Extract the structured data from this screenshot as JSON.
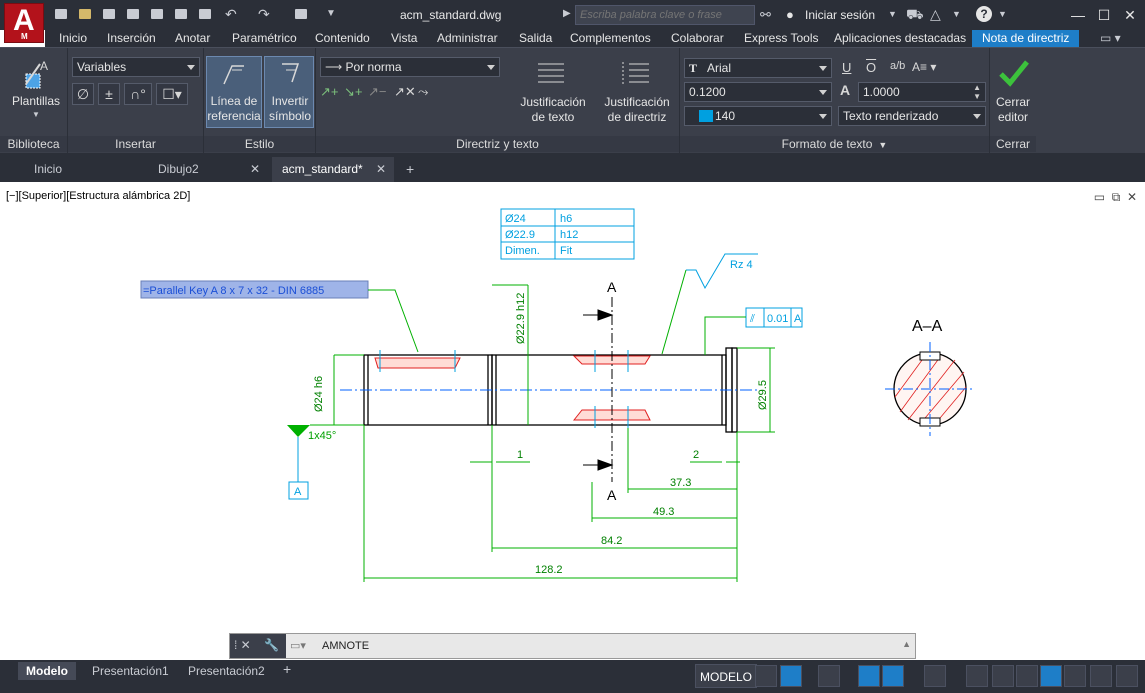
{
  "app": {
    "logo_letter": "A",
    "logo_sub": "M",
    "title": "acm_standard.dwg"
  },
  "search": {
    "placeholder": "Escriba palabra clave o frase"
  },
  "account": {
    "signin": "Iniciar sesión"
  },
  "ribbon_tabs": [
    "Inicio",
    "Inserción",
    "Anotar",
    "Paramétrico",
    "Contenido",
    "Vista",
    "Administrar",
    "Salida",
    "Complementos",
    "Colaborar",
    "Express Tools",
    "Aplicaciones destacadas",
    "Nota de directriz"
  ],
  "active_ribbon_tab": "Nota de directriz",
  "ribbon": {
    "biblioteca": {
      "button": "Plantillas",
      "title": "Biblioteca"
    },
    "insertar": {
      "combo": "Variables",
      "title": "Insertar"
    },
    "estilo": {
      "btn1_line1": "Línea de",
      "btn1_line2": "referencia",
      "btn2_line1": "Invertir",
      "btn2_line2": "símbolo",
      "title": "Estilo"
    },
    "directriz": {
      "combo": "Por norma",
      "btn1_line1": "Justificación",
      "btn1_line2": "de texto",
      "btn2_line1": "Justificación",
      "btn2_line2": "de directriz",
      "title": "Directriz y texto"
    },
    "formato": {
      "font": "Arial",
      "height": "0.1200",
      "width_factor": "1.0000",
      "color": "140",
      "render": "Texto renderizado",
      "title": "Formato de texto"
    },
    "cerrar": {
      "line1": "Cerrar",
      "line2": "editor",
      "title": "Cerrar"
    }
  },
  "doc_tabs": [
    "Inicio",
    "Dibujo2",
    "acm_standard*"
  ],
  "viewport_label": "[−][Superior][Estructura alámbrica 2D]",
  "drawing": {
    "note_text": "=Parallel Key A 8 x 7 x 32 - DIN 6885",
    "fit_table": [
      [
        "Ø24",
        "h6"
      ],
      [
        "Ø22.9",
        "h12"
      ],
      [
        "Dimen.",
        "Fit"
      ]
    ],
    "roughness": "Rz 4",
    "section_label": "A",
    "section_view": "A–A",
    "tolerance_value": "0.01",
    "tolerance_datum": "A",
    "datum": "A",
    "chamfer": "1x45°",
    "dims": {
      "dia24": "Ø24 h6",
      "dia229": "Ø22.9 h12",
      "dia295": "Ø29.5",
      "d1": "1",
      "d2": "2",
      "d373": "37.3",
      "d493": "49.3",
      "d842": "84.2",
      "d1282": "128.2"
    }
  },
  "command": {
    "prompt": "AMNOTE"
  },
  "status_tabs": [
    "Modelo",
    "Presentación1",
    "Presentación2"
  ],
  "status": {
    "model": "MODELO"
  },
  "colors": {
    "accent": "#1e7ec8",
    "dim_green": "#00b000",
    "cyan": "#00a0e0",
    "hatch_red": "#e02020"
  }
}
